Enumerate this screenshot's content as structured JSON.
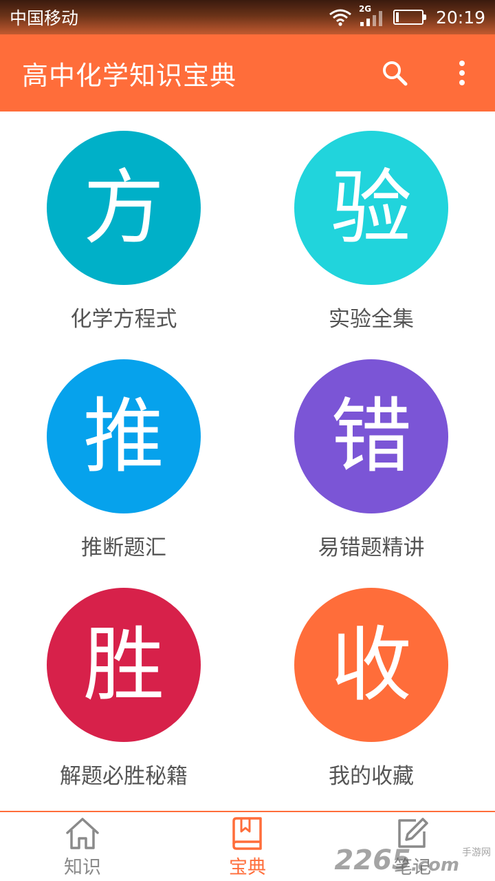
{
  "status_bar": {
    "carrier": "中国移动",
    "network": "2G",
    "time": "20:19",
    "battery_percent": 10
  },
  "app_bar": {
    "title": "高中化学知识宝典",
    "search_icon": "search-icon",
    "more_icon": "more-vertical-icon"
  },
  "tiles": [
    {
      "glyph": "方",
      "label": "化学方程式",
      "color": "#00b0c8"
    },
    {
      "glyph": "验",
      "label": "实验全集",
      "color": "#21d4dc"
    },
    {
      "glyph": "推",
      "label": "推断题汇",
      "color": "#06a2ec"
    },
    {
      "glyph": "错",
      "label": "易错题精讲",
      "color": "#7b55d6"
    },
    {
      "glyph": "胜",
      "label": "解题必胜秘籍",
      "color": "#d7214a"
    },
    {
      "glyph": "收",
      "label": "我的收藏",
      "color": "#ff6d3a"
    }
  ],
  "bottom_nav": [
    {
      "label": "知识",
      "icon": "home-icon",
      "active": false
    },
    {
      "label": "宝典",
      "icon": "book-icon",
      "active": true
    },
    {
      "label": "笔记",
      "icon": "edit-note-icon",
      "active": false
    }
  ],
  "colors": {
    "accent": "#ff6d3a",
    "inactive": "#8a8a8a"
  },
  "watermark": {
    "number": "2265",
    "suffix": ".com",
    "sub": "手游网"
  }
}
